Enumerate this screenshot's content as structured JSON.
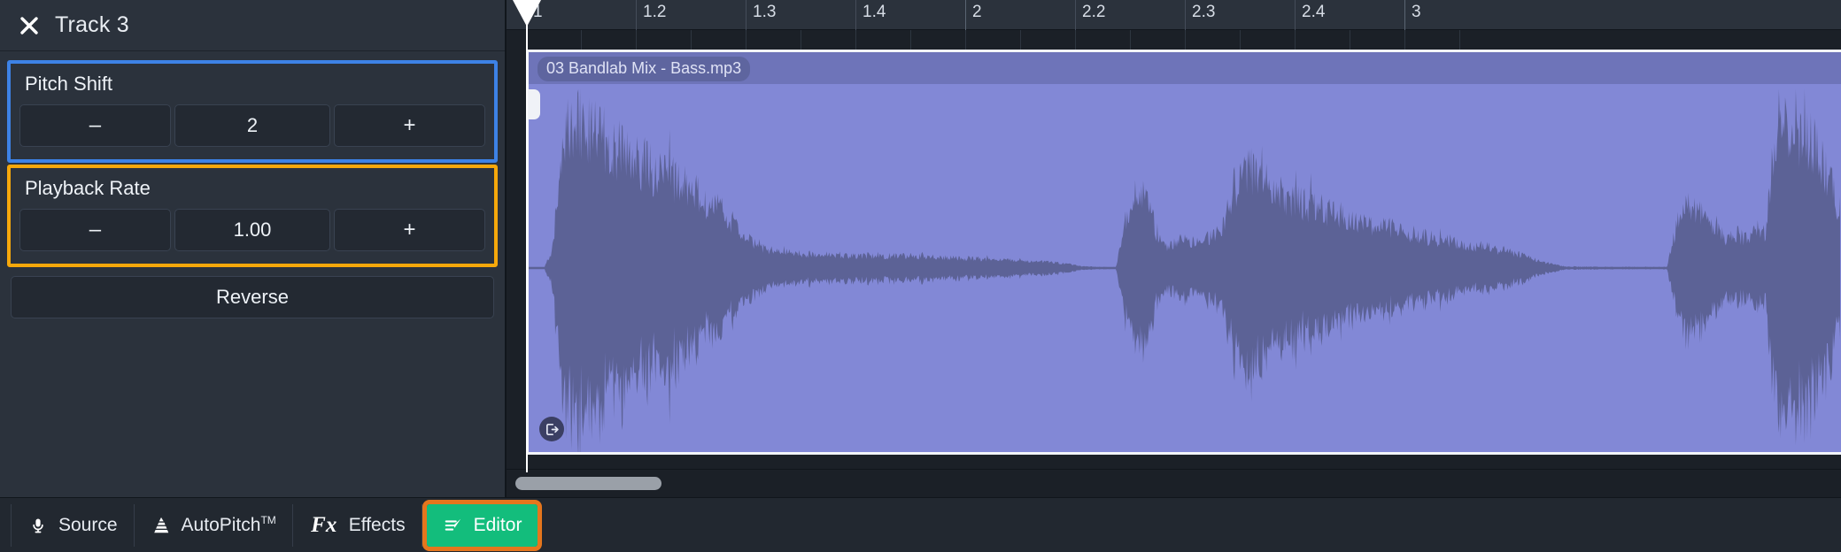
{
  "panel": {
    "title": "Track 3",
    "close_icon": "close-icon",
    "groups": [
      {
        "id": "pitch-shift",
        "label": "Pitch Shift",
        "value": "2",
        "decrement_label": "–",
        "increment_label": "+",
        "highlight_color": "#3d82e6"
      },
      {
        "id": "playback-rate",
        "label": "Playback Rate",
        "value": "1.00",
        "decrement_label": "–",
        "increment_label": "+",
        "highlight_color": "#f6a80b"
      }
    ],
    "reverse_label": "Reverse"
  },
  "timeline": {
    "ruler_labels": [
      "1",
      "1.2",
      "1.3",
      "1.4",
      "2",
      "2.2",
      "2.3",
      "2.4",
      "3"
    ],
    "clip": {
      "name": "03 Bandlab Mix - Bass.mp3",
      "background_color": "#8288d6",
      "waveform_color": "#5c6296",
      "badge_icon": "export-arrow-icon"
    },
    "playhead_position_label": "1",
    "scrollbar": {
      "thumb_position": "left"
    }
  },
  "tabs": [
    {
      "label": "Source",
      "icon": "microphone-icon",
      "active": false
    },
    {
      "label": "AutoPitch",
      "trademark": "TM",
      "icon": "layers-cone-icon",
      "active": false
    },
    {
      "label": "Effects",
      "icon": "fx-icon",
      "active": false
    },
    {
      "label": "Editor",
      "icon": "editor-pen-icon",
      "active": true
    }
  ],
  "colors": {
    "panel_bg": "#2b323c",
    "timeline_bg": "#1b2027",
    "accent_blue": "#3d82e6",
    "accent_amber": "#f6a80b",
    "accent_green": "#13bd7c",
    "accent_orange": "#e5761d"
  }
}
